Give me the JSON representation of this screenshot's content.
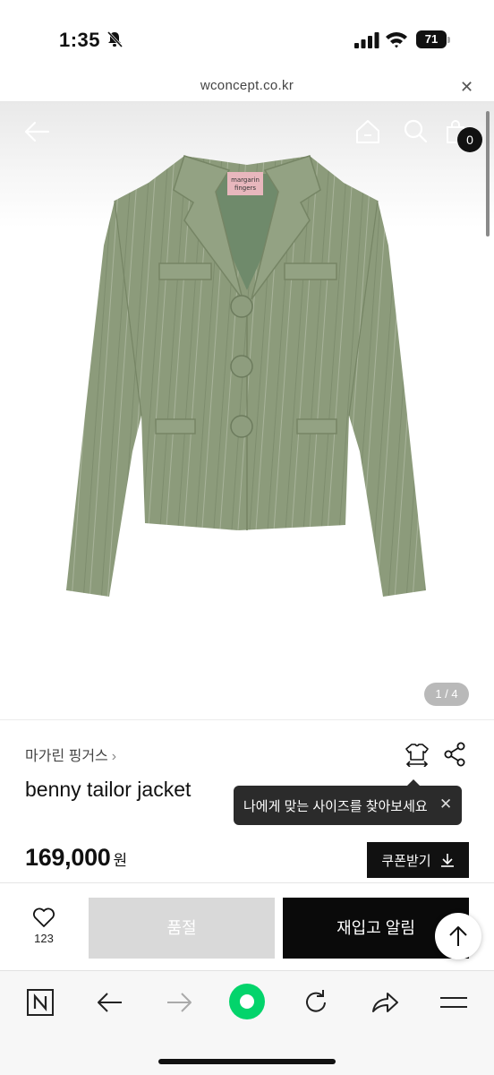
{
  "status_bar": {
    "time": "1:35",
    "battery": "71",
    "icons": [
      "bell-muted-icon",
      "signal-icon",
      "wifi-icon",
      "battery-icon"
    ]
  },
  "browser": {
    "url": "wconcept.co.kr",
    "close_glyph": "✕"
  },
  "product_page": {
    "header_icons": [
      "back-arrow-icon",
      "home-icon",
      "search-icon",
      "shopping-bag-icon"
    ],
    "cart_count": "0",
    "image_pager": "1 / 4",
    "brand": "마가린 핑거스",
    "brand_chevron": "›",
    "title": "benny tailor jacket",
    "price": "169,000",
    "currency": "원",
    "coupon_label": "쿠폰받기",
    "size_tooltip": "나에게 맞는 사이즈를 찾아보세요",
    "tooltip_close": "✕",
    "jacket_label_text": "margarin fingers"
  },
  "purchase_bar": {
    "like_count": "123",
    "soldout_label": "품절",
    "restock_label": "재입고 알림"
  },
  "colors": {
    "jacket_green": "#8a9a78",
    "accent_black": "#0a0a0a",
    "soldout_gray": "#d9d9d9",
    "naver_green": "#03d46b"
  },
  "toolbar_icons": [
    "naver-n-icon",
    "back-icon",
    "forward-icon",
    "green-dot-icon",
    "reload-icon",
    "share-icon",
    "menu-icon"
  ]
}
